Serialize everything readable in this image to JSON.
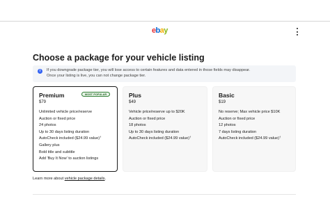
{
  "header": {
    "logo_text": "ebay",
    "logo_colors": [
      "#e53238",
      "#0064d2",
      "#f5af02",
      "#86b817"
    ],
    "menu_icon": "more-vertical-icon"
  },
  "page": {
    "title": "Choose a package for your vehicle listing"
  },
  "notice": {
    "icon": "info-icon",
    "line1": "If you downgrade package tier, you will lose access to certain features and data entered in those fields may disappear.",
    "line2": "Once your listing is live, you can not change package tier."
  },
  "packages": [
    {
      "name": "Premium",
      "price": "$79",
      "badge": "MOST POPULAR",
      "selected": true,
      "features": [
        "Unlimited vehicle price/reserve",
        "Auction or fixed price",
        "24 photos",
        "Up to 30 days listing duration",
        "AutoCheck included ($24.99 value)",
        "Gallery plus",
        "Bold title and subtitle",
        "Add 'Buy It Now' to auction listings"
      ]
    },
    {
      "name": "Plus",
      "price": "$49",
      "selected": false,
      "features": [
        "Vehicle price/reserve up to $20K",
        "Auction or fixed price",
        "18 photos",
        "Up to 30 days listing duration",
        "AutoCheck included ($24.99 value)"
      ]
    },
    {
      "name": "Basic",
      "price": "$19",
      "selected": false,
      "features": [
        "No reserve; Max vehicle price $10K",
        "Auction or fixed price",
        "12 photos",
        "7 days listing duration",
        "AutoCheck included ($24.99 value)"
      ]
    }
  ],
  "footnote_mark": "†",
  "learn_more": {
    "prefix": "Learn more about ",
    "link": "vehicle package details",
    "suffix": "."
  },
  "colors": {
    "selected_border": "#191919",
    "unselected_bg": "#f7f7f7",
    "notice_bg": "#f3f5f8",
    "info_blue": "#3665f3",
    "badge_green": "#2e7d32"
  }
}
